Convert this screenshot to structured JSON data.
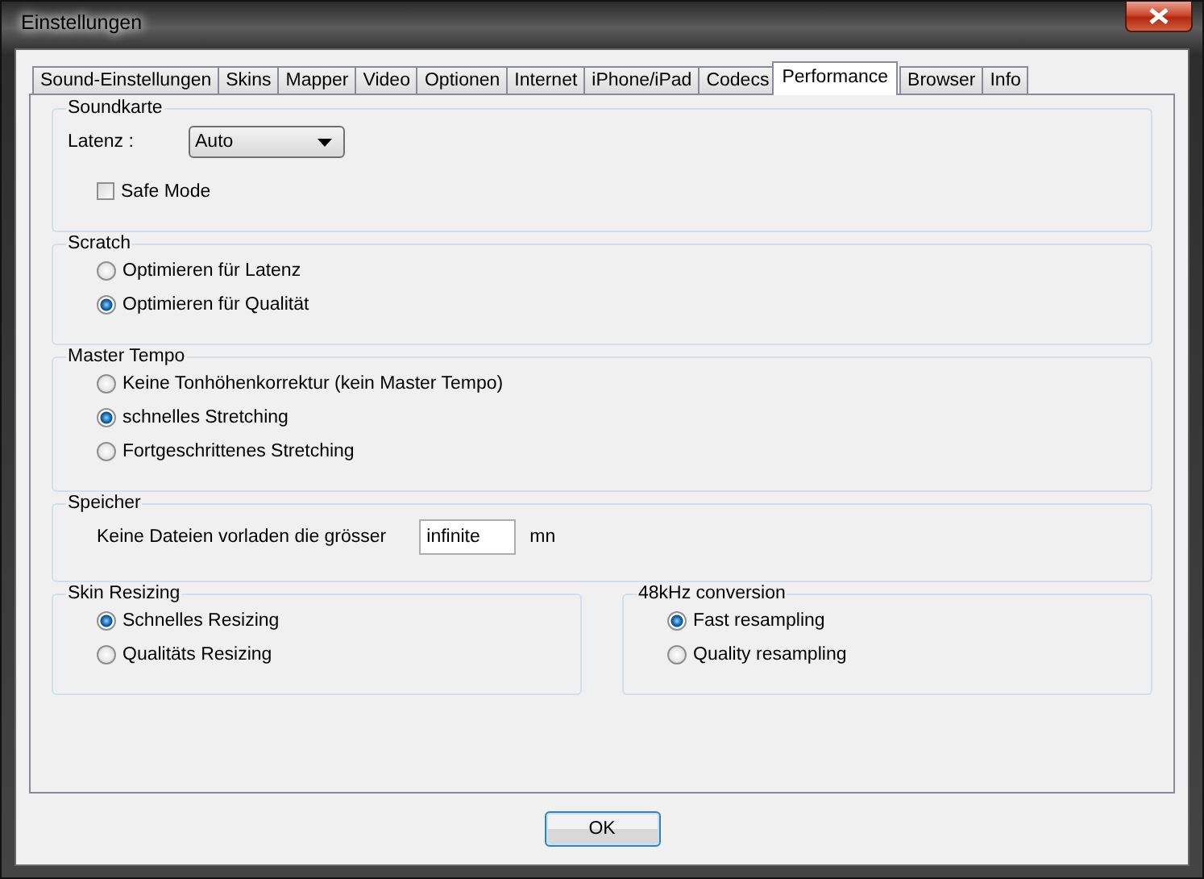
{
  "window": {
    "title": "Einstellungen"
  },
  "tabs": [
    {
      "label": "Sound-Einstellungen",
      "selected": false
    },
    {
      "label": "Skins",
      "selected": false
    },
    {
      "label": "Mapper",
      "selected": false
    },
    {
      "label": "Video",
      "selected": false
    },
    {
      "label": "Optionen",
      "selected": false
    },
    {
      "label": "Internet",
      "selected": false
    },
    {
      "label": "iPhone/iPad",
      "selected": false
    },
    {
      "label": "Codecs",
      "selected": false
    },
    {
      "label": "Performance",
      "selected": true
    },
    {
      "label": "Browser",
      "selected": false
    },
    {
      "label": "Info",
      "selected": false
    }
  ],
  "group_rows": [
    [
      {
        "title": "Soundkarte",
        "items": [
          {
            "kind": "dropdown",
            "label": "Latenz :",
            "value": "Auto"
          },
          {
            "kind": "checkbox",
            "label": "Safe Mode",
            "checked": false
          }
        ]
      }
    ],
    [
      {
        "title": "Scratch",
        "items": [
          {
            "kind": "radio",
            "label": "Optimieren für Latenz",
            "selected": false
          },
          {
            "kind": "radio",
            "label": "Optimieren für Qualität",
            "selected": true
          }
        ]
      }
    ],
    [
      {
        "title": "Master Tempo",
        "items": [
          {
            "kind": "radio",
            "label": "Keine Tonhöhenkorrektur (kein Master Tempo)",
            "selected": false
          },
          {
            "kind": "radio",
            "label": "schnelles Stretching",
            "selected": true
          },
          {
            "kind": "radio",
            "label": "Fortgeschrittenes Stretching",
            "selected": false
          }
        ]
      }
    ],
    [
      {
        "title": "Speicher",
        "items": [
          {
            "kind": "textfield",
            "label": "Keine Dateien vorladen die grösser",
            "value": "infinite",
            "unit": "mn"
          }
        ]
      }
    ],
    [
      {
        "title": "Skin Resizing",
        "items": [
          {
            "kind": "radio",
            "label": "Schnelles Resizing",
            "selected": true
          },
          {
            "kind": "radio",
            "label": "Qualitäts Resizing",
            "selected": false
          }
        ]
      },
      {
        "title": "48kHz conversion",
        "items": [
          {
            "kind": "radio",
            "label": "Fast resampling",
            "selected": true
          },
          {
            "kind": "radio",
            "label": "Quality resampling",
            "selected": false
          }
        ]
      }
    ]
  ],
  "buttons": [
    {
      "label": "OK"
    }
  ]
}
